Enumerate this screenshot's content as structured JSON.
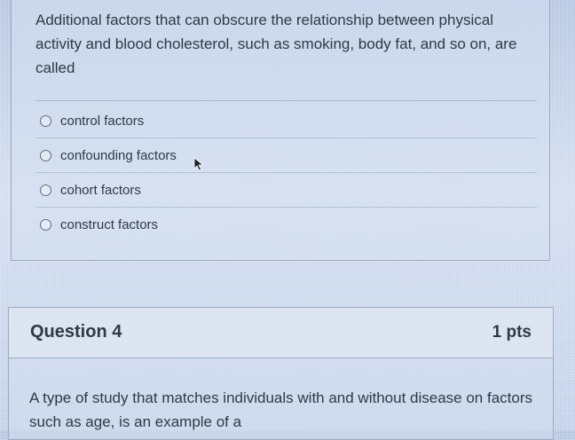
{
  "question3": {
    "text": "Additional factors that can obscure the relationship between physical activity and blood cholesterol, such as smoking, body fat, and so on, are called",
    "options": [
      {
        "label": "control factors"
      },
      {
        "label": "confounding factors"
      },
      {
        "label": "cohort factors"
      },
      {
        "label": "construct factors"
      }
    ]
  },
  "question4": {
    "title": "Question 4",
    "points": "1 pts",
    "text": "A type of study that matches individuals with and without disease on factors such as age, is an example of a"
  },
  "colors": {
    "text": "#2d3b45",
    "border": "#9eabbf",
    "background": "#c9d6ea"
  }
}
